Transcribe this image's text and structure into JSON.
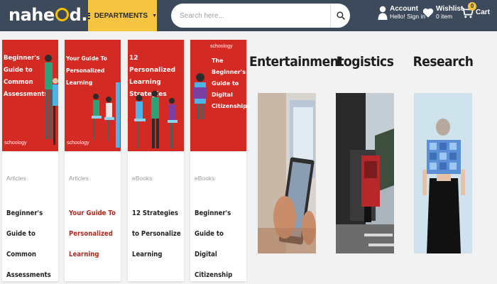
{
  "header": {
    "logo_text": "nahe",
    "logo_text_after": "d.pk",
    "departments_label": "DEPARTMENTS",
    "search_placeholder": "Search here...",
    "account": {
      "title": "Account",
      "subtitle": "Hello! Sign in"
    },
    "wishlist": {
      "title": "Wishlist",
      "subtitle": "0 item"
    },
    "cart": {
      "title": "Cart",
      "count": "0"
    }
  },
  "articles": [
    {
      "thumb_title": "Beginner's Guide to Common Assessments",
      "brand": "schoology",
      "category": "Articles",
      "title": "Beginner's Guide to Common Assessments",
      "title_highlight": false
    },
    {
      "thumb_title": "Your Guide To Personalized Learning",
      "brand": "schoology",
      "category": "Articles",
      "title": "Your Guide To Personalized Learning",
      "title_highlight": true
    },
    {
      "thumb_title": "12 Personalized Learning Strategies",
      "brand": "",
      "category": "eBooks",
      "title": "12 Strategies to Personalize Learning",
      "title_highlight": false
    },
    {
      "thumb_title": "The Beginner's Guide to Digital Citizenship",
      "brand": "schoology",
      "category": "eBooks",
      "title": "Beginner's Guide to Digital Citizenship",
      "title_highlight": false
    }
  ],
  "categories": [
    {
      "label": "Entertainment"
    },
    {
      "label": "Logistics"
    },
    {
      "label": "Research"
    }
  ],
  "colors": {
    "header_bg": "#3d4a5c",
    "accent_yellow": "#f5c542",
    "card_red": "#d42a24",
    "highlight_title": "#b0271f"
  }
}
